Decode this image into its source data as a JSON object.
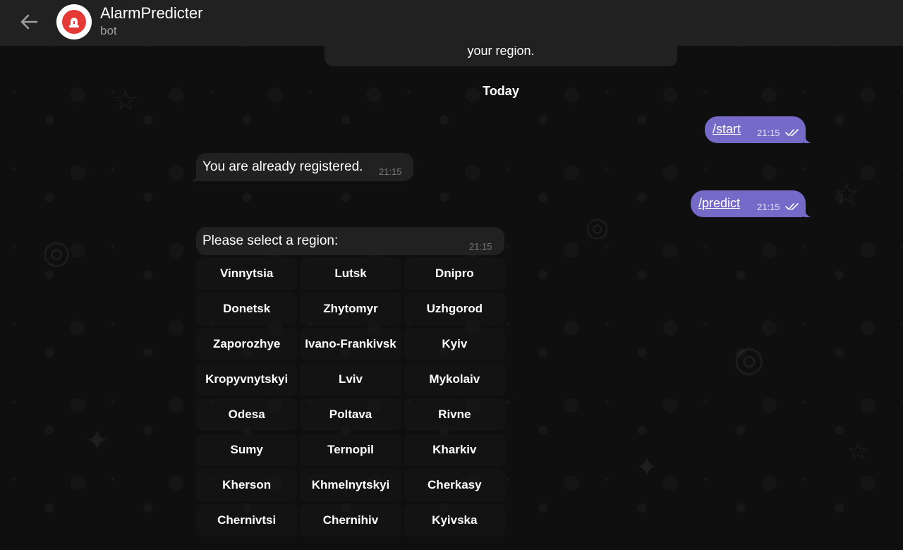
{
  "header": {
    "back_icon": "arrow-left-icon",
    "avatar_icon": "alarm-siren-icon",
    "title": "AlarmPredicter",
    "subtitle": "bot"
  },
  "messages": {
    "previous_tail": "your region.",
    "date_separator": "Today",
    "start": {
      "text": "/start",
      "time": "21:15",
      "status": "read"
    },
    "registered": {
      "text": "You are already registered.",
      "time": "21:15"
    },
    "predict": {
      "text": "/predict",
      "time": "21:15",
      "status": "read"
    },
    "select": {
      "text": "Please select a region:",
      "time": "21:15"
    }
  },
  "keyboard": {
    "rows": [
      [
        "Vinnytsia",
        "Lutsk",
        "Dnipro"
      ],
      [
        "Donetsk",
        "Zhytomyr",
        "Uzhgorod"
      ],
      [
        "Zaporozhye",
        "Ivano-Frankivsk",
        "Kyiv"
      ],
      [
        "Kropyvnytskyi",
        "Lviv",
        "Mykolaiv"
      ],
      [
        "Odesa",
        "Poltava",
        "Rivne"
      ],
      [
        "Sumy",
        "Ternopil",
        "Kharkiv"
      ],
      [
        "Kherson",
        "Khmelnytskyi",
        "Cherkasy"
      ],
      [
        "Chernivtsi",
        "Chernihiv",
        "Kyivska"
      ]
    ]
  },
  "colors": {
    "outgoing_bubble": "#766ac8",
    "incoming_bubble": "#212121",
    "header_bg": "#212121",
    "avatar_red": "#e53935"
  }
}
